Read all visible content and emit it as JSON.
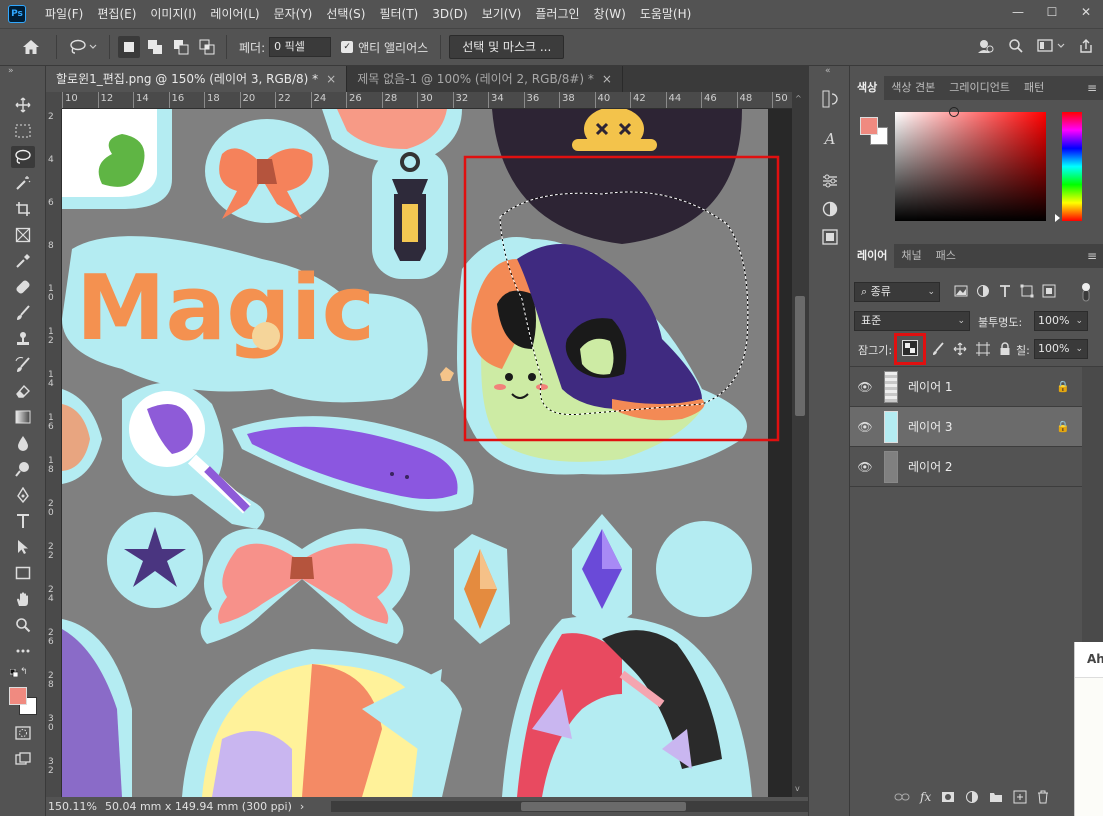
{
  "app": {
    "logo": "Ps"
  },
  "menu": [
    "파일(F)",
    "편집(E)",
    "이미지(I)",
    "레이어(L)",
    "문자(Y)",
    "선택(S)",
    "필터(T)",
    "3D(D)",
    "보기(V)",
    "플러그인",
    "창(W)",
    "도움말(H)"
  ],
  "window_controls": {
    "minimize": "—",
    "maximize": "☐",
    "close": "✕"
  },
  "options": {
    "feather_label": "페더:",
    "feather_value": "0 픽셀",
    "antialias_checked": "✓",
    "antialias_label": "앤티 앨리어스",
    "select_mask_label": "선택 및 마스크 ..."
  },
  "tabs": [
    {
      "label": "할로윈1_편집.png @ 150% (레이어 3, RGB/8) *",
      "close": "×"
    },
    {
      "label": "제목 없음-1 @ 100% (레이어 2, RGB/8#) *",
      "close": "×"
    }
  ],
  "ruler_top": [
    "10",
    "12",
    "14",
    "16",
    "18",
    "20",
    "22",
    "24",
    "26",
    "28",
    "30",
    "32",
    "34",
    "36",
    "38",
    "40",
    "42",
    "44",
    "46",
    "48",
    "50"
  ],
  "ruler_left": [
    "2",
    "4",
    "6",
    "8",
    "10",
    "12",
    "14",
    "16",
    "18",
    "20",
    "22",
    "24",
    "26",
    "28",
    "30",
    "32"
  ],
  "canvas": {
    "text": "Magic"
  },
  "status": {
    "zoom": "150.11%",
    "size": "50.04 mm x 149.94 mm (300 ppi)",
    "arrow": "›"
  },
  "color_panel": {
    "tabs": [
      "색상",
      "색상 견본",
      "그레이디언트",
      "패턴"
    ]
  },
  "layers_panel": {
    "tabs": [
      "레이어",
      "채널",
      "패스"
    ],
    "filter_label": "종류",
    "blend_mode": "표준",
    "opacity_label": "불투명도:",
    "opacity_value": "100%",
    "lock_label": "잠그기:",
    "fill_label": "칠:",
    "fill_value": "100%",
    "layers": [
      {
        "name": "레이어 1",
        "locked": "🔒"
      },
      {
        "name": "레이어 3",
        "locked": "🔒"
      },
      {
        "name": "레이어 2",
        "locked": ""
      }
    ],
    "footer_fx": "fx"
  },
  "floating": {
    "text": "Ah"
  },
  "colors": {
    "foreground": "#f08a80",
    "background": "#ffffff",
    "highlight_box": "#e01010",
    "sticker_outline": "#b4ecf2",
    "canvas_gray": "#808080"
  }
}
